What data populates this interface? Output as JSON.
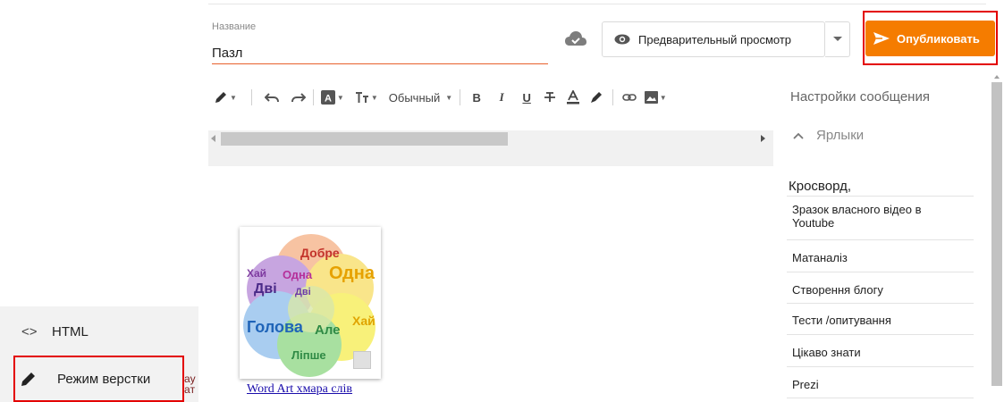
{
  "header": {
    "title_label": "Название",
    "title_value": "Пазл",
    "preview_label": "Предварительный просмотр",
    "publish_label": "Опубликовать"
  },
  "toolbar": {
    "format_label": "Обычный",
    "icons": [
      "pen-icon",
      "undo-icon",
      "redo-icon",
      "text-style-icon",
      "font-size-icon",
      "bold-icon",
      "italic-icon",
      "underline-icon",
      "strikethrough-icon",
      "text-color-icon",
      "highlight-icon",
      "link-icon",
      "image-icon"
    ],
    "bold_glyph": "B",
    "italic_glyph": "I",
    "underline_glyph": "U"
  },
  "editor": {
    "image_caption": "Word Art хмара слів",
    "art_words": [
      "Добре",
      "Одна",
      "Хай",
      "Дві",
      "Голова",
      "Але",
      "Лiпше"
    ]
  },
  "settings": {
    "title": "Настройки сообщения",
    "labels_heading": "Ярлыки",
    "labels_input": "Кросворд,",
    "label_items": [
      "Зразок власного відео в Youtube",
      "Матаналіз",
      "Створення блогу",
      "Тести /опитування",
      "Цікаво знати",
      "Prezi"
    ]
  },
  "mode_menu": {
    "html_label": "HTML",
    "html_glyph": "<>",
    "layout_label": "Режим верстки"
  },
  "clipped_text": "ay\naт",
  "colors": {
    "accent": "#f57c00",
    "highlight_box": "#e30000",
    "link": "#1a0dab",
    "input_underline": "#e8602c"
  }
}
